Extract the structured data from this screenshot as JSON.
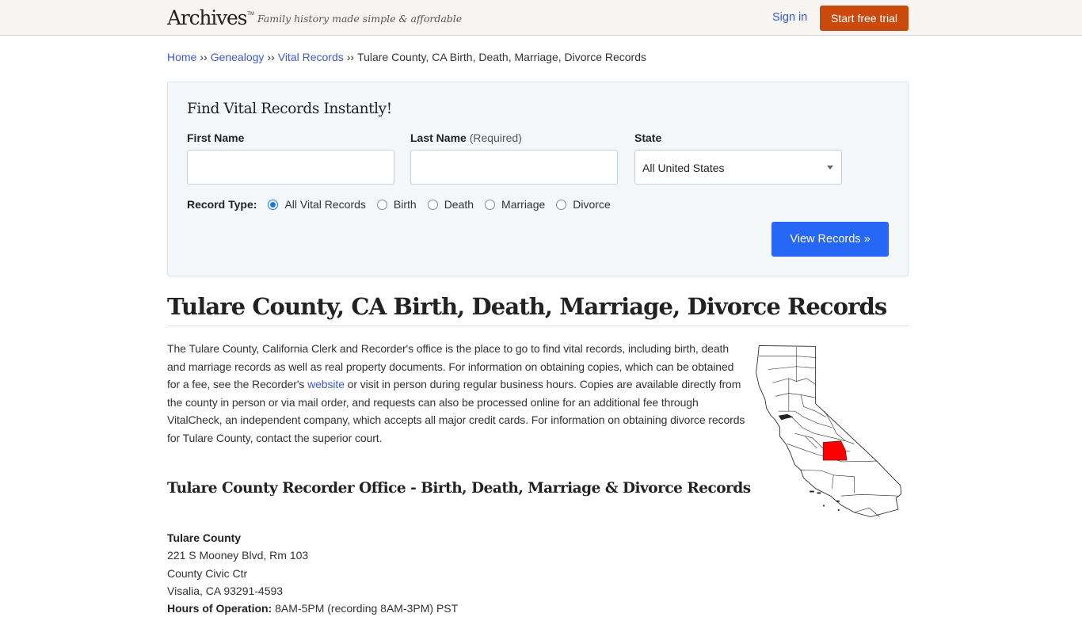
{
  "header": {
    "logo": "Archives",
    "logo_tm": "TM",
    "tagline": "Family history made simple & affordable",
    "sign_in": "Sign in",
    "start_trial": "Start free trial"
  },
  "breadcrumb": {
    "items": [
      "Home",
      "Genealogy",
      "Vital Records"
    ],
    "separator": "››",
    "current": "Tulare County, CA Birth, Death, Marriage, Divorce Records"
  },
  "search": {
    "title": "Find Vital Records Instantly!",
    "first_name_label": "First Name",
    "first_name_value": "",
    "last_name_label": "Last Name",
    "last_name_required": "(Required)",
    "last_name_value": "",
    "state_label": "State",
    "state_value": "All United States",
    "record_type_label": "Record Type:",
    "record_types": [
      {
        "label": "All Vital Records",
        "checked": true
      },
      {
        "label": "Birth",
        "checked": false
      },
      {
        "label": "Death",
        "checked": false
      },
      {
        "label": "Marriage",
        "checked": false
      },
      {
        "label": "Divorce",
        "checked": false
      }
    ],
    "submit": "View Records »"
  },
  "page": {
    "title": "Tulare County, CA Birth, Death, Marriage, Divorce Records",
    "intro_part1": "The Tulare County, California Clerk and Recorder's office is the place to go to find vital records, including birth, death and marriage records as well as real property documents. For information on obtaining copies, which can be obtained for a fee, see the Recorder's ",
    "intro_link": "website",
    "intro_part2": " or visit in person during regular business hours. Copies are available directly from the county in person or via mail order, and requests can also be processed online for an additional fee through VitalCheck, an independent company, which accepts all major credit cards. For information on obtaining divorce records for Tulare County, contact the superior court.",
    "map_highlight_color": "#ff0000",
    "subtitle": "Tulare County Recorder Office - Birth, Death, Marriage & Divorce Records"
  },
  "office": {
    "name": "Tulare County",
    "address1": "221 S Mooney Blvd, Rm 103",
    "address2": "County Civic Ctr",
    "address3": "Visalia, CA 93291-4593",
    "hours_label": "Hours of Operation:",
    "hours_value": "8AM-5PM (recording 8AM-3PM) PST"
  }
}
